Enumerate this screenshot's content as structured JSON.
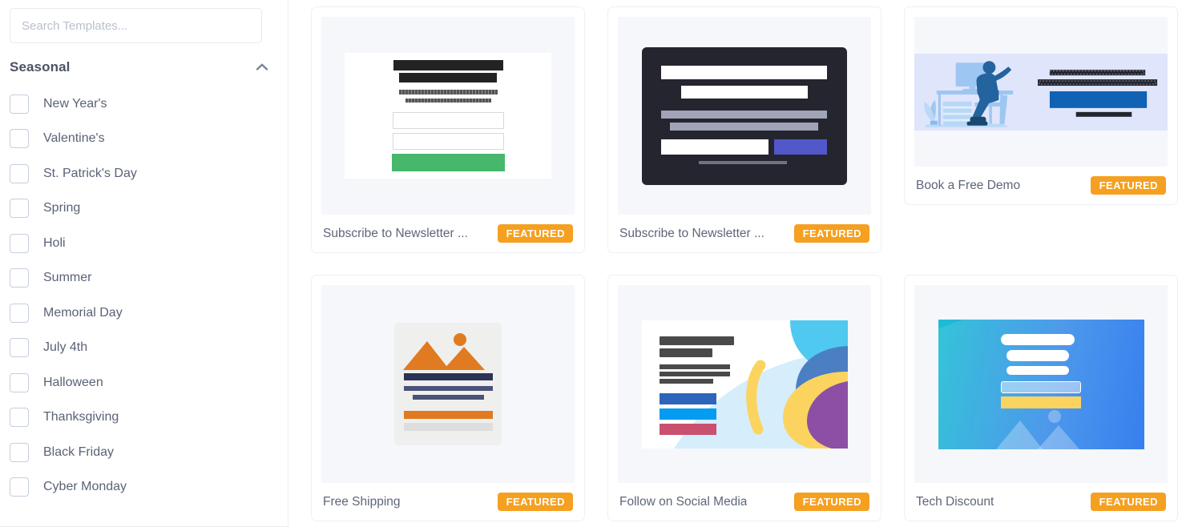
{
  "sidebar": {
    "search": {
      "placeholder": "Search Templates...",
      "value": ""
    },
    "group": {
      "title": "Seasonal",
      "collapse_icon": "chevron-up-icon",
      "expanded": true
    },
    "items": [
      {
        "label": "New Year's",
        "checked": false
      },
      {
        "label": "Valentine's",
        "checked": false
      },
      {
        "label": "St. Patrick's Day",
        "checked": false
      },
      {
        "label": "Spring",
        "checked": false
      },
      {
        "label": "Holi",
        "checked": false
      },
      {
        "label": "Summer",
        "checked": false
      },
      {
        "label": "Memorial Day",
        "checked": false
      },
      {
        "label": "July 4th",
        "checked": false
      },
      {
        "label": "Halloween",
        "checked": false
      },
      {
        "label": "Thanksgiving",
        "checked": false
      },
      {
        "label": "Black Friday",
        "checked": false
      },
      {
        "label": "Cyber Monday",
        "checked": false
      }
    ]
  },
  "colors": {
    "badge_orange": "#f5a020",
    "badge_text": "#ffffff",
    "title_text": "#5e6677",
    "sidebar_label": "#5a6276",
    "card_border": "#eef0f5",
    "thumb_bg": "#f5f7fb",
    "checkbox_border": "#c6cddd",
    "accent_green": "#46b76b",
    "accent_purple": "#5257ca",
    "accent_blue": "#1062b4",
    "accent_orange": "#e07b21",
    "accent_yellow": "#fad45f"
  },
  "templates": [
    {
      "title": "Subscribe to Newsletter ...",
      "badge": "FEATURED",
      "preview": "light-newsletter-form"
    },
    {
      "title": "Subscribe to Newsletter ...",
      "badge": "FEATURED",
      "preview": "dark-newsletter-form"
    },
    {
      "title": "Book a Free Demo",
      "badge": "FEATURED",
      "preview": "desk-person-illustration"
    },
    {
      "title": "Free Shipping",
      "badge": "FEATURED",
      "preview": "image-placeholder-card"
    },
    {
      "title": "Follow on Social Media",
      "badge": "FEATURED",
      "preview": "social-shapes-banner"
    },
    {
      "title": "Tech Discount",
      "badge": "FEATURED",
      "preview": "blue-gradient-banner"
    }
  ]
}
